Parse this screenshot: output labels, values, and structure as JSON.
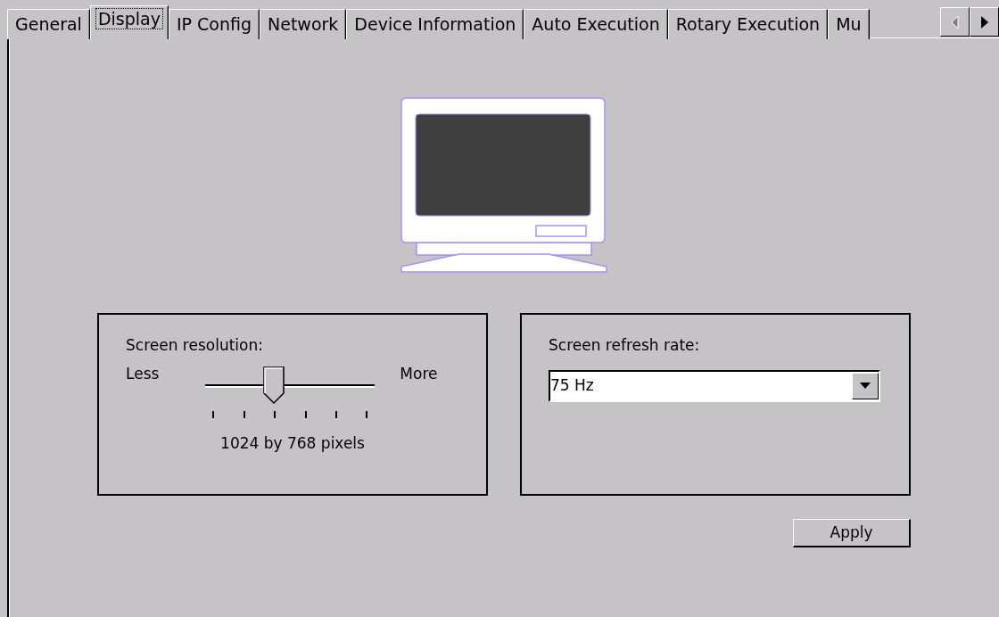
{
  "tabs": [
    {
      "label": "General",
      "selected": false
    },
    {
      "label": "Display",
      "selected": true
    },
    {
      "label": "IP Config",
      "selected": false
    },
    {
      "label": "Network",
      "selected": false
    },
    {
      "label": "Device Information",
      "selected": false
    },
    {
      "label": "Auto Execution",
      "selected": false
    },
    {
      "label": "Rotary Execution",
      "selected": false
    },
    {
      "label": "Mu",
      "selected": false
    }
  ],
  "tab_scroll": {
    "left_disabled": true,
    "right_disabled": false
  },
  "resolution": {
    "title": "Screen resolution:",
    "min_label": "Less",
    "max_label": "More",
    "level": 0.4,
    "reading": "1024 by 768 pixels"
  },
  "refresh": {
    "title": "Screen refresh rate:",
    "value": "75 Hz"
  },
  "apply_button": "Apply"
}
